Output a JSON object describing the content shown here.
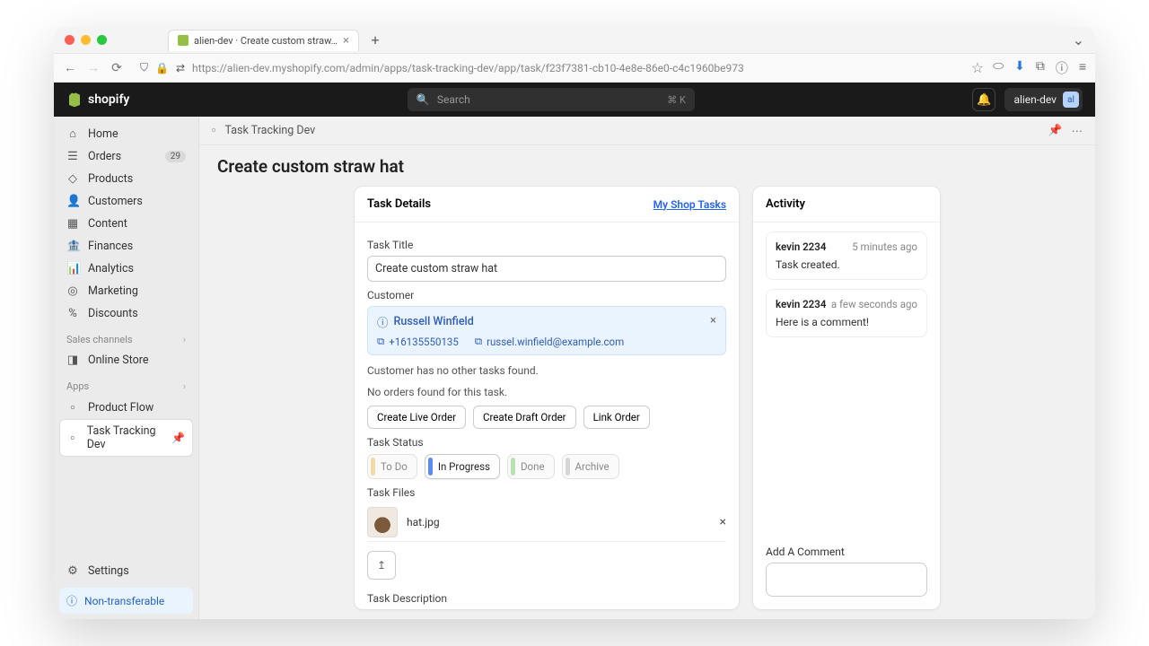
{
  "browser": {
    "tab_title": "alien-dev · Create custom straw…",
    "url": "https://alien-dev.myshopify.com/admin/apps/task-tracking-dev/app/task/f23f7381-cb10-4e8e-86e0-c4c1960be973"
  },
  "topbar": {
    "brand": "shopify",
    "search_placeholder": "Search",
    "search_kbd": "⌘ K",
    "store_name": "alien-dev",
    "store_initials": "al"
  },
  "sidebar": {
    "items": [
      {
        "label": "Home"
      },
      {
        "label": "Orders",
        "badge": "29"
      },
      {
        "label": "Products"
      },
      {
        "label": "Customers"
      },
      {
        "label": "Content"
      },
      {
        "label": "Finances"
      },
      {
        "label": "Analytics"
      },
      {
        "label": "Marketing"
      },
      {
        "label": "Discounts"
      }
    ],
    "channels_head": "Sales channels",
    "channels": [
      {
        "label": "Online Store"
      }
    ],
    "apps_head": "Apps",
    "apps": [
      {
        "label": "Product Flow"
      },
      {
        "label": "Task Tracking Dev",
        "selected": true
      }
    ],
    "settings": "Settings",
    "non_transferable": "Non-transferable"
  },
  "crumb": {
    "app": "Task Tracking Dev"
  },
  "page": {
    "title": "Create custom straw hat"
  },
  "details": {
    "head": "Task Details",
    "link": "My Shop Tasks",
    "title_label": "Task Title",
    "title_value": "Create custom straw hat",
    "customer_label": "Customer",
    "customer_name": "Russell Winfield",
    "customer_phone": "+16135550135",
    "customer_email": "russel.winfield@example.com",
    "no_tasks": "Customer has no other tasks found.",
    "no_orders": "No orders found for this task.",
    "btn_live": "Create Live Order",
    "btn_draft": "Create Draft Order",
    "btn_link": "Link Order",
    "status_label": "Task Status",
    "statuses": [
      {
        "label": "To Do",
        "color": "#f3d9a4"
      },
      {
        "label": "In Progress",
        "color": "#5b8def",
        "active": true
      },
      {
        "label": "Done",
        "color": "#b7e3b0"
      },
      {
        "label": "Archive",
        "color": "#d6d6d6"
      }
    ],
    "files_label": "Task Files",
    "file_name": "hat.jpg",
    "desc_label": "Task Description"
  },
  "activity": {
    "head": "Activity",
    "items": [
      {
        "who": "kevin 2234",
        "when": "5 minutes ago",
        "body": "Task created."
      },
      {
        "who": "kevin 2234",
        "when": "a few seconds ago",
        "body": "Here is a comment!"
      }
    ],
    "comment_label": "Add A Comment"
  }
}
